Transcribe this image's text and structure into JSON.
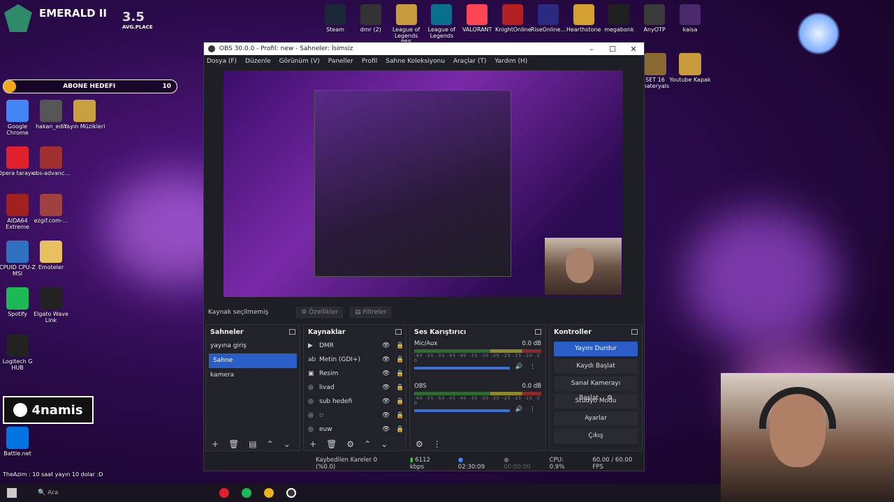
{
  "overlay": {
    "rank": "EMERALD II",
    "lp": "3.5",
    "lp_label": "AVG.PLACE",
    "abone_label": "ABONE HEDEFI",
    "abone_count": "10",
    "streamer": "4namis",
    "chat_line": "TheAzim : 10 saat yayın 10 dolar :D"
  },
  "top_icons": [
    "Steam",
    "dmr (2)",
    "League of Legends PBE",
    "League of Legends",
    "VALORANT",
    "KnightOnline",
    "RiseOnline...",
    "Hearthstone",
    "megabonk",
    "AnyOTP",
    "kaisa"
  ],
  "left_icons": [
    "Google Chrome",
    "hakan_edit",
    "Yayın Müzikleri",
    "Opera tarayıcı",
    "obs-advanc...",
    "AIDA64 Extreme",
    "ezgif.com-...",
    "CPUID CPU-Z MSI",
    "Emoteler",
    "Spotify",
    "Elgato Wave Link",
    "Logitech G HUB",
    "Battle.net"
  ],
  "right_icons": [
    "SET 16 materyals",
    "Youtube Kapak"
  ],
  "obs": {
    "title": "OBS 30.0.0 - Profil: new - Sahneler: İsimsiz",
    "menu": [
      "Dosya (F)",
      "Düzenle",
      "Görünüm (V)",
      "Paneller",
      "Profil",
      "Sahne Koleksiyonu",
      "Araçlar (T)",
      "Yardım (H)"
    ],
    "context": {
      "no_source": "Kaynak seçilmemiş",
      "properties": "Özellikler",
      "filters": "Filtreler"
    },
    "scenes_title": "Sahneler",
    "scenes": [
      "yayına giriş",
      "Sahne",
      "kamera"
    ],
    "sources_title": "Kaynaklar",
    "sources": [
      "DMR",
      "Metin (GDI+)",
      "Resim",
      "livad",
      "sub hedefi",
      "tr",
      "euw"
    ],
    "mixer_title": "Ses Karıştırıcı",
    "mixer": [
      {
        "name": "Mic/Aux",
        "db": "0.0 dB"
      },
      {
        "name": "OBS",
        "db": "0.0 dB"
      }
    ],
    "mixer_scale": "-60 -55 -50 -45 -40 -35 -30 -25 -20 -15 -10 -5 0",
    "controls_title": "Kontroller",
    "controls": [
      "Yayını Durdur",
      "Kaydı Başlat",
      "Sanal Kamerayı Başlat",
      "Stüdyo Modu",
      "Ayarlar",
      "Çıkış"
    ],
    "status": {
      "dropped": "Kaybedilen Kareler 0 (%0.0)",
      "bitrate": "6112 kbps",
      "stream_time": "02:30:09",
      "rec_time": "00:00:00",
      "cpu": "CPU: 0.9%",
      "fps": "60.00 / 60.00 FPS"
    }
  },
  "taskbar": {
    "search": "Ara"
  }
}
